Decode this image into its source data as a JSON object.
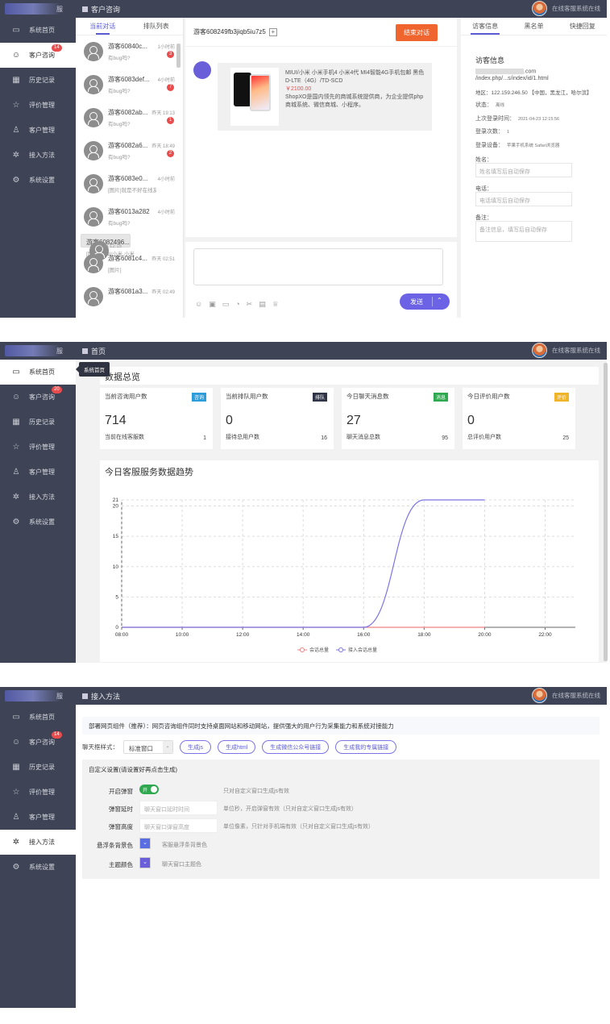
{
  "sidebar": {
    "logo_text": "服",
    "items": [
      {
        "label": "系统首页",
        "icon": "monitor-icon"
      },
      {
        "label": "客户咨询",
        "icon": "smile-icon"
      },
      {
        "label": "历史记录",
        "icon": "calendar-icon"
      },
      {
        "label": "评价管理",
        "icon": "star-icon"
      },
      {
        "label": "客户管理",
        "icon": "user-icon"
      },
      {
        "label": "接入方法",
        "icon": "gear-icon"
      },
      {
        "label": "系统设置",
        "icon": "cog-icon"
      }
    ],
    "badge_p1": "14",
    "badge_p2": "20",
    "badge_p3": "14"
  },
  "header": {
    "user_status": "在线客服系统在线",
    "p1_title": "客户咨询",
    "p2_title": "首页",
    "p3_title": "接入方法"
  },
  "chat_list": {
    "tabs": [
      "当前对话",
      "排队列表"
    ],
    "items": [
      {
        "name": "游客60840c...",
        "time": "1小时前",
        "msg": "有bug吗?",
        "badge": "3"
      },
      {
        "name": "游客6083def...",
        "time": "4小时前",
        "msg": "有bug吗?",
        "badge": "7"
      },
      {
        "name": "游客6082ab...",
        "time": "昨天 19:13",
        "msg": "有bug吗?",
        "badge": "1"
      },
      {
        "name": "游客6082a6...",
        "time": "昨天 18:49",
        "msg": "有bug吗?",
        "badge": "2"
      },
      {
        "name": "游客6083e0...",
        "time": "4小时前",
        "msg": "[图片]就是不好在线友...",
        "badge": ""
      },
      {
        "name": "游客6013a282",
        "time": "4小时前",
        "msg": "有bug吗?",
        "badge": ""
      },
      {
        "name": "游客6082496...",
        "time": "昨天 12:15",
        "msg": "[图片]MIUI/小米 小米...",
        "badge": ""
      },
      {
        "name": "游客6081c4...",
        "time": "昨天 02:51",
        "msg": "[图片]",
        "badge": ""
      },
      {
        "name": "游客6081a3...",
        "time": "昨天 02:49",
        "msg": "",
        "badge": ""
      }
    ]
  },
  "chat": {
    "visitor_id": "游客608249fb3jiqb5iu7z5",
    "end_button": "结束对话",
    "product_title": "MIUI/小米 小米手机4 小米4代 MI4智能4G手机包邮 黑色 D-LTE（4G）/TD-SCD",
    "product_price": "￥2100.00",
    "product_desc": "ShopXO是国内领先的商城系统提供商，为企业提供php商城系统、微信商城、小程序。",
    "send_label": "发送",
    "toolbar_icons": [
      "smile-icon",
      "image-icon",
      "folder-icon",
      "video-icon",
      "scissors-icon",
      "card-icon",
      "rate-icon"
    ]
  },
  "visitor": {
    "tabs": [
      "访客信息",
      "黑名单",
      "快捷回复"
    ],
    "title": "访客信息",
    "url_line1": ".com",
    "url_line2": "/index.php/...s/index/id/1.html",
    "region": "地区：122.159.246.50 【中国，黑龙江，哈尔滨】",
    "status_label": "状态：",
    "status_value": "离线",
    "last_login_label": "上次登录时间：",
    "last_login_value": "2021-04-23 12:15:56",
    "login_count_label": "登录次数：",
    "login_count_value": "1",
    "device_label": "登录设备：",
    "device_value": "苹果手机系统 Safari浏览器",
    "name_label": "姓名：",
    "name_placeholder": "姓名填写后自动保存",
    "phone_label": "电话：",
    "phone_placeholder": "电话填写后自动保存",
    "note_label": "备注：",
    "note_placeholder": "备注信息，填写后自动保存"
  },
  "dashboard": {
    "tooltip": "系统首页",
    "overview_title": "数据总览",
    "stats": [
      {
        "label": "当前咨询用户数",
        "tag": "咨询",
        "tag_color": "#2d9cdb",
        "value": "714",
        "sub": "当前在线客服数",
        "subv": "1"
      },
      {
        "label": "当前排队用户数",
        "tag": "排队",
        "tag_color": "#2f3546",
        "value": "0",
        "sub": "接待总用户数",
        "subv": "16"
      },
      {
        "label": "今日聊天消息数",
        "tag": "消息",
        "tag_color": "#2fa84f",
        "value": "27",
        "sub": "聊天消息总数",
        "subv": "95"
      },
      {
        "label": "今日评价用户数",
        "tag": "评价",
        "tag_color": "#f0b429",
        "value": "0",
        "sub": "总评价用户数",
        "subv": "25"
      }
    ],
    "trend_title": "今日客服服务数据趋势"
  },
  "chart_data": {
    "type": "line",
    "title": "今日客服服务数据趋势",
    "x": [
      "08:00",
      "10:00",
      "12:00",
      "14:00",
      "16:00",
      "18:00",
      "20:00",
      "22:00"
    ],
    "yticks": [
      0,
      5,
      10,
      15,
      20,
      21
    ],
    "ylim": [
      0,
      21
    ],
    "xlim": [
      8,
      23
    ],
    "series": [
      {
        "name": "会话总量",
        "color": "#f08080",
        "points": [
          [
            8,
            0
          ],
          [
            16,
            0
          ],
          [
            18,
            0
          ],
          [
            20,
            0
          ]
        ]
      },
      {
        "name": "接入会话总量",
        "color": "#7b74e6",
        "points": [
          [
            8,
            0
          ],
          [
            16,
            0
          ],
          [
            18,
            21
          ],
          [
            20,
            21
          ]
        ]
      }
    ],
    "grid": true,
    "legend": "bottom"
  },
  "access": {
    "notice": "部署网页组件（推荐）：网页咨询组件同时支持桌面网站和移动网站，提供强大的用户行为采集能力和系统对接能力",
    "style_label": "聊天框样式：",
    "style_value": "标准窗口",
    "buttons": [
      "生成js",
      "生成html",
      "生成微信公众号链接",
      "生成我的专属链接"
    ],
    "custom_title": "自定义设置(请设置好再点击生成)",
    "rows": [
      {
        "label": "开启弹窗",
        "toggle": "开",
        "hint": "只对自定义窗口生成js有效"
      },
      {
        "label": "弹窗延时",
        "placeholder": "聊天窗口延时时间",
        "hint": "单位秒，开启弹窗有效（只对自定义窗口生成js有效）"
      },
      {
        "label": "弹窗高度",
        "placeholder": "聊天窗口弹窗高度",
        "hint": "单位像素，只针对手机端有效（只对自定义窗口生成js有效）"
      },
      {
        "label": "悬浮条背景色",
        "hint": "客服悬浮条背景色"
      },
      {
        "label": "主题颜色",
        "hint": "聊天窗口主题色"
      }
    ]
  }
}
